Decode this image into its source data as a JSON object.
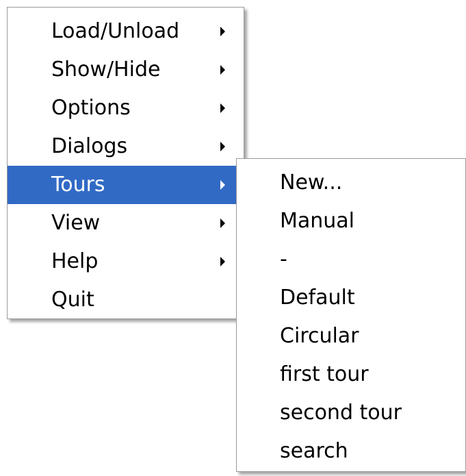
{
  "main_menu": {
    "items": [
      {
        "label": "Load/Unload",
        "has_submenu": true
      },
      {
        "label": "Show/Hide",
        "has_submenu": true
      },
      {
        "label": "Options",
        "has_submenu": true
      },
      {
        "label": "Dialogs",
        "has_submenu": true
      },
      {
        "label": "Tours",
        "has_submenu": true,
        "highlighted": true
      },
      {
        "label": "View",
        "has_submenu": true
      },
      {
        "label": "Help",
        "has_submenu": true
      },
      {
        "label": "Quit",
        "has_submenu": false
      }
    ]
  },
  "tours_submenu": {
    "items": [
      {
        "label": "New..."
      },
      {
        "label": "Manual"
      },
      {
        "label": "-"
      },
      {
        "label": "Default"
      },
      {
        "label": "Circular"
      },
      {
        "label": "first tour"
      },
      {
        "label": "second tour"
      },
      {
        "label": "search"
      }
    ]
  },
  "colors": {
    "highlight_background": "#316ac5",
    "highlight_text": "#ffffff",
    "menu_background": "#ffffff",
    "menu_border": "#9a9a9a"
  },
  "icons": {
    "submenu_arrow": "chevron-right-icon"
  }
}
